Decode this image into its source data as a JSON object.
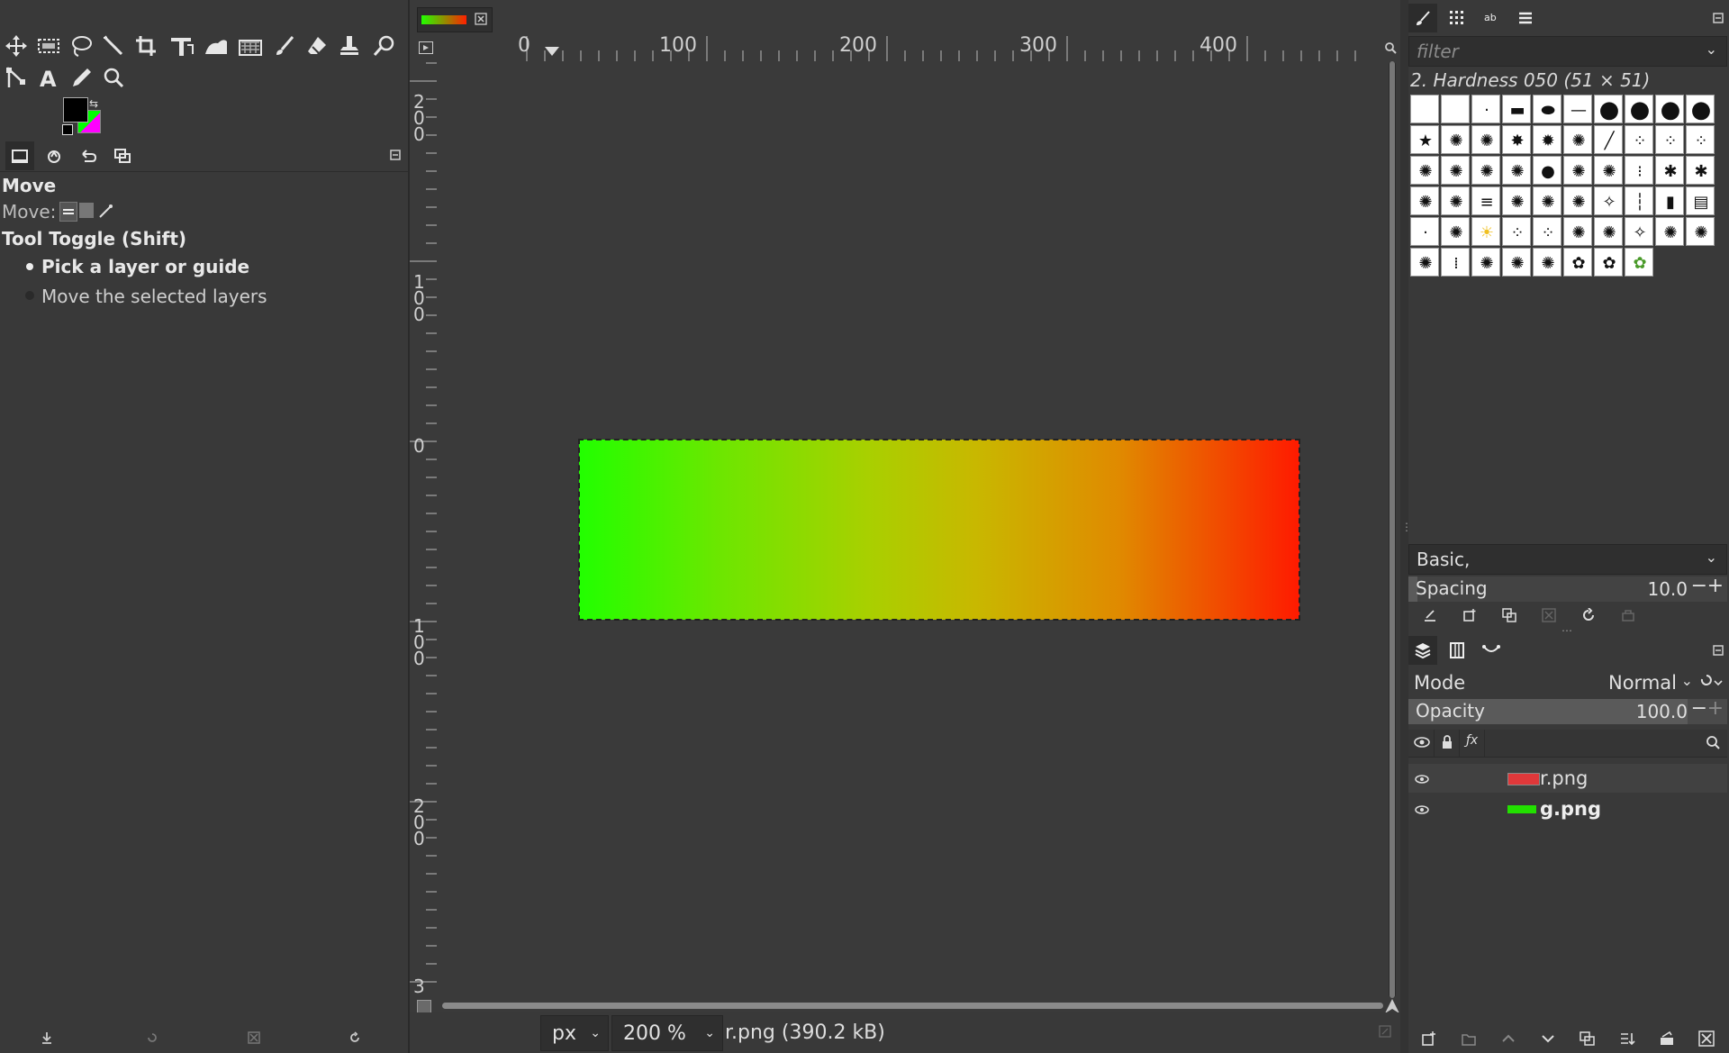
{
  "tool_options": {
    "title": "Move",
    "move_label": "Move:",
    "toggle_label": "Tool Toggle  (Shift)",
    "option_pick": "Pick a layer or guide",
    "option_move": "Move the selected layers"
  },
  "rulers": {
    "h_labels": [
      "0",
      "100",
      "200",
      "300",
      "400"
    ],
    "v_labels": [
      "2\n0\n0",
      "1\n0\n0",
      "0",
      "1\n0\n0",
      "2\n0\n0",
      "3"
    ]
  },
  "status": {
    "unit": "px",
    "zoom": "200 %",
    "file_info": "r.png (390.2 kB)"
  },
  "brushes": {
    "filter_placeholder": "filter",
    "selected_brush": "2. Hardness 050 (51 × 51)",
    "preset": "Basic,",
    "spacing_label": "Spacing",
    "spacing_value": "10.0"
  },
  "layers": {
    "mode_label": "Mode",
    "mode_value": "Normal",
    "opacity_label": "Opacity",
    "opacity_value": "100.0",
    "items": [
      {
        "name": "r.png",
        "thumb_color": "#e0383a"
      },
      {
        "name": "g.png",
        "thumb_color": "#22e000"
      }
    ]
  },
  "colors": {
    "foreground": "#000000",
    "background": "#00ff00",
    "accent": "#ff00ff"
  }
}
